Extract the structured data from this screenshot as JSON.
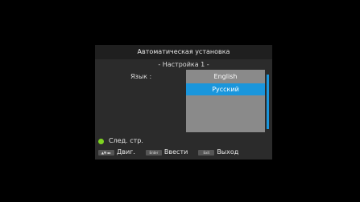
{
  "dialog": {
    "title": "Автоматическая установка",
    "subtitle": "- Настройка 1 -",
    "language_label": "Язык :",
    "languages": [
      {
        "label": "English",
        "selected": false
      },
      {
        "label": "Русский",
        "selected": true
      }
    ]
  },
  "footer": {
    "next_label": "След. стр.",
    "hints": {
      "arrows_key": "▲▼◄►",
      "arrows_label": "Двиг.",
      "enter_key": "Enter",
      "enter_label": "Ввести",
      "exit_key": "Exit",
      "exit_label": "Выход"
    }
  },
  "colors": {
    "background": "#000000",
    "dialog_body": "#2b2b2b",
    "dialog_header": "#1f1f1f",
    "list_background": "#8a8a8a",
    "selection": "#1a96dc",
    "green_button": "#7ed321"
  }
}
